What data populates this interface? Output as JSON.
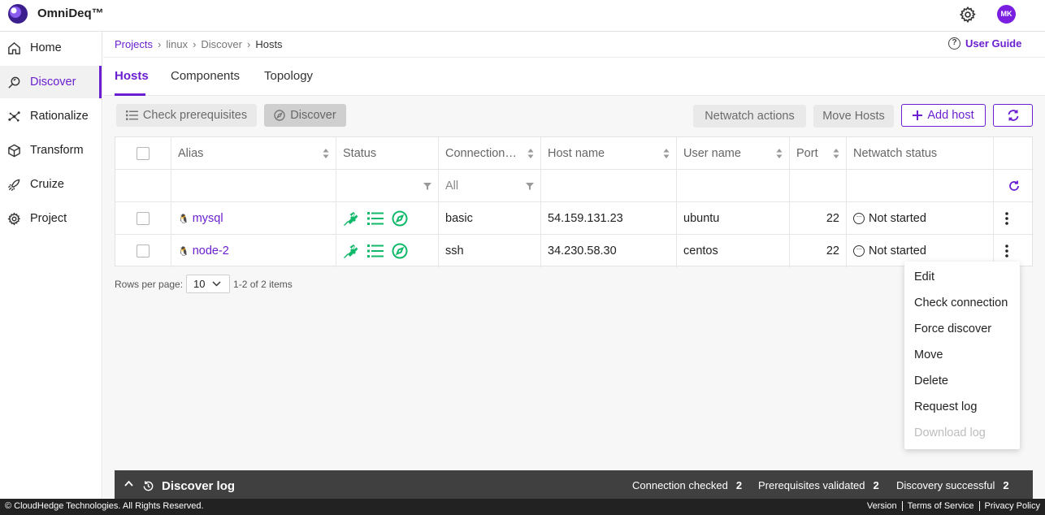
{
  "app": {
    "brand": "OmniDeq™",
    "avatar_initials": "MK",
    "accent": "#6a1fd0"
  },
  "sidebar": {
    "items": [
      {
        "label": "Home",
        "icon": "home-icon"
      },
      {
        "label": "Discover",
        "icon": "discover-icon",
        "active": true
      },
      {
        "label": "Rationalize",
        "icon": "rationalize-icon"
      },
      {
        "label": "Transform",
        "icon": "cube-icon"
      },
      {
        "label": "Cruize",
        "icon": "rocket-icon"
      },
      {
        "label": "Project",
        "icon": "gear-icon"
      }
    ]
  },
  "breadcrumb": {
    "items": [
      "Projects",
      "linux",
      "Discover",
      "Hosts"
    ]
  },
  "user_guide": {
    "label": "User Guide"
  },
  "tabs": [
    {
      "label": "Hosts"
    },
    {
      "label": "Components"
    },
    {
      "label": "Topology"
    }
  ],
  "toolbar": {
    "check_prerequisites": "Check prerequisites",
    "discover": "Discover",
    "netwatch_actions": "Netwatch actions",
    "move_hosts": "Move Hosts",
    "add_host": "Add host"
  },
  "table": {
    "columns": [
      "Alias",
      "Status",
      "Connection…",
      "Host name",
      "User name",
      "Port",
      "Netwatch status"
    ],
    "filters": {
      "connection": "All"
    },
    "rows": [
      {
        "alias": "mysql",
        "connection": "basic",
        "host_name": "54.159.131.23",
        "user_name": "ubuntu",
        "port": "22",
        "netwatch_status": "Not started"
      },
      {
        "alias": "node-2",
        "connection": "ssh",
        "host_name": "34.230.58.30",
        "user_name": "centos",
        "port": "22",
        "netwatch_status": "Not started"
      }
    ]
  },
  "pagination": {
    "label": "Rows per page:",
    "value": "10",
    "range": "1-2 of 2 items"
  },
  "context_menu": {
    "items": [
      "Edit",
      "Check connection",
      "Force discover",
      "Move",
      "Delete",
      "Request log",
      "Download log"
    ]
  },
  "discover_log": {
    "title": "Discover log",
    "stats": [
      {
        "label": "Connection checked",
        "value": "2"
      },
      {
        "label": "Prerequisites validated",
        "value": "2"
      },
      {
        "label": "Discovery successful",
        "value": "2"
      }
    ]
  },
  "footer": {
    "copyright": "© CloudHedge Technologies. All Rights Reserved.",
    "links": [
      "Version",
      "Terms of Service",
      "Privacy Policy"
    ]
  }
}
